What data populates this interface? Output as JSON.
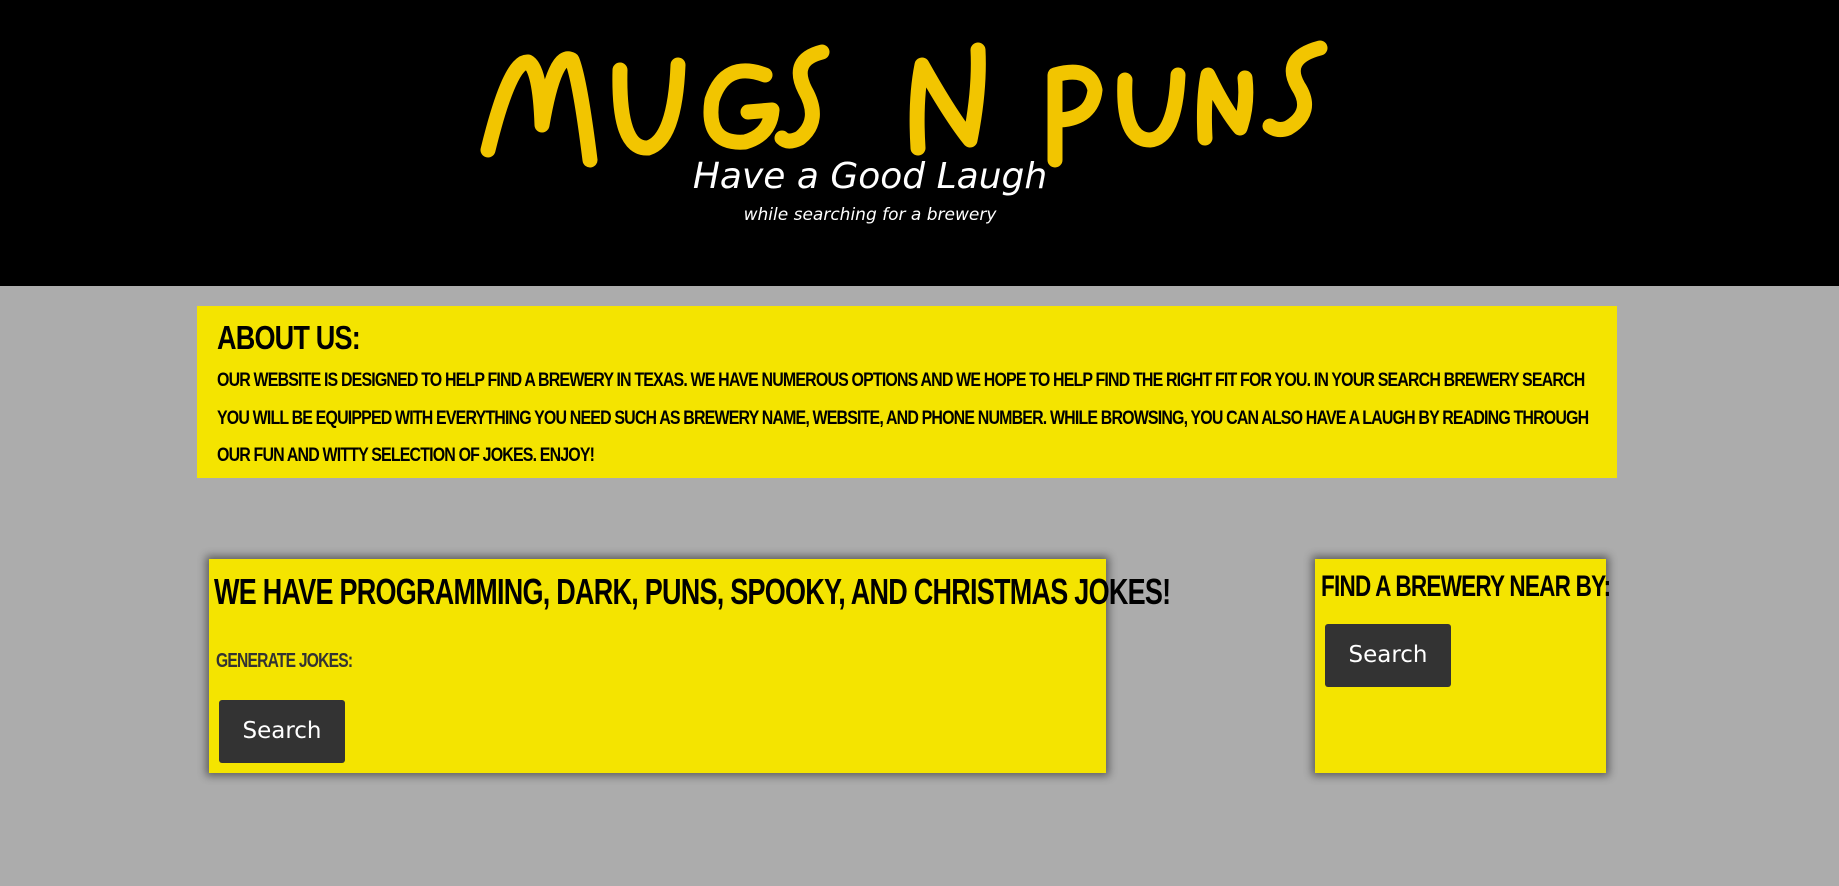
{
  "header": {
    "logo_title": "MUGS N PUNS",
    "logo_tagline": "Have a Good Laugh",
    "logo_subtagline": "while searching for a brewery",
    "background_color": "#000000",
    "logo_color": "#f2c500"
  },
  "about": {
    "heading": "About Us:",
    "text": "Our website is designed to help find a brewery in Texas. We have numerous options and we hope to help find the right fit for you. In your search brewery search you will be equipped with everything you need such as brewery name, website, and phone number. While browsing, you can also have a laugh by reading through our fun and witty selection of jokes. Enjoy!"
  },
  "jokes": {
    "title": "We have Programming, Dark, Puns, Spooky, and Christmas jokes!",
    "generate_label": "Generate Jokes:",
    "button_label": "Search"
  },
  "brewery": {
    "title": "Find a brewery near by:",
    "button_label": "Search"
  },
  "colors": {
    "page_background": "#acacac",
    "panel_yellow": "#f4e400",
    "button_dark": "#333333"
  }
}
